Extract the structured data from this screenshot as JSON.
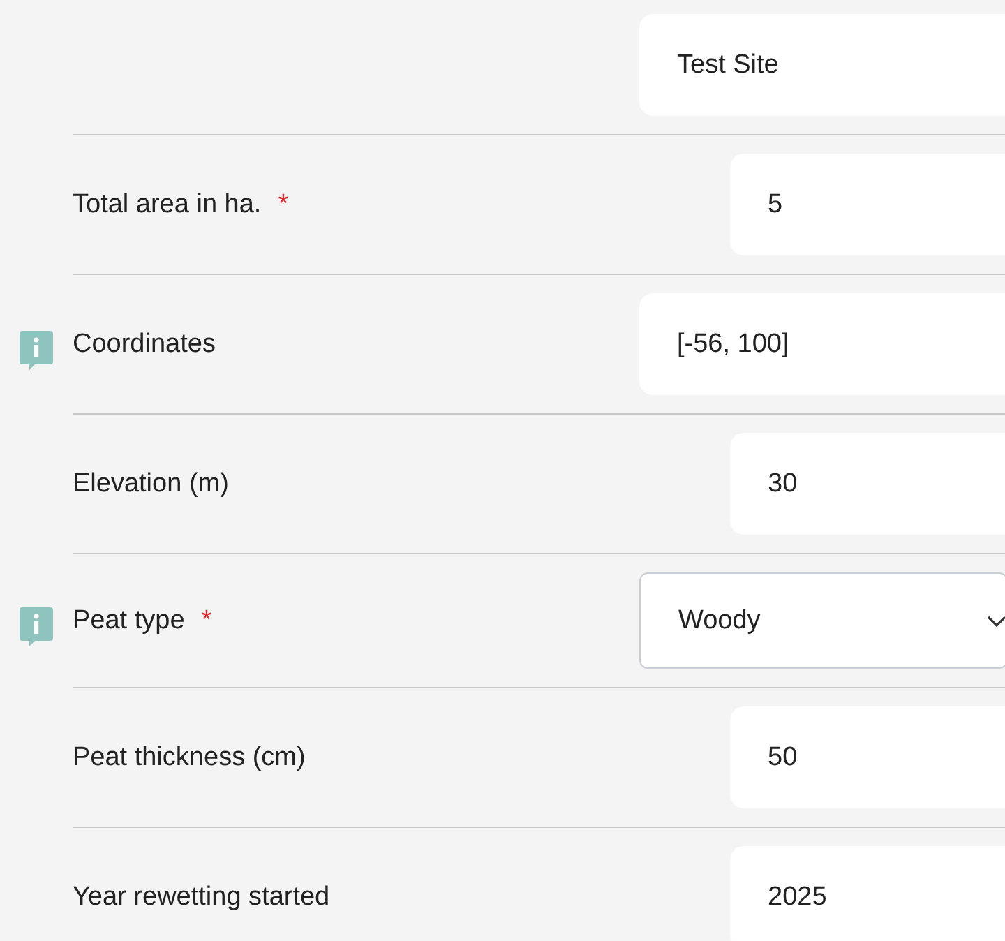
{
  "rows": [
    {
      "kind": "text",
      "info": false,
      "value": "Test Site"
    },
    {
      "kind": "number",
      "label": "Total area in ha.",
      "required_mark": "*",
      "info": false,
      "value": "5"
    },
    {
      "kind": "text",
      "label": "Coordinates",
      "info": true,
      "value": "[-56, 100]"
    },
    {
      "kind": "number",
      "label": "Elevation (m)",
      "info": false,
      "value": "30"
    },
    {
      "kind": "select",
      "label": "Peat type",
      "required_mark": "*",
      "info": true,
      "value": "Woody"
    },
    {
      "kind": "number",
      "label": "Peat thickness (cm)",
      "info": false,
      "value": "50"
    },
    {
      "kind": "number",
      "label": "Year rewetting started",
      "info": false,
      "value": "2025"
    }
  ]
}
